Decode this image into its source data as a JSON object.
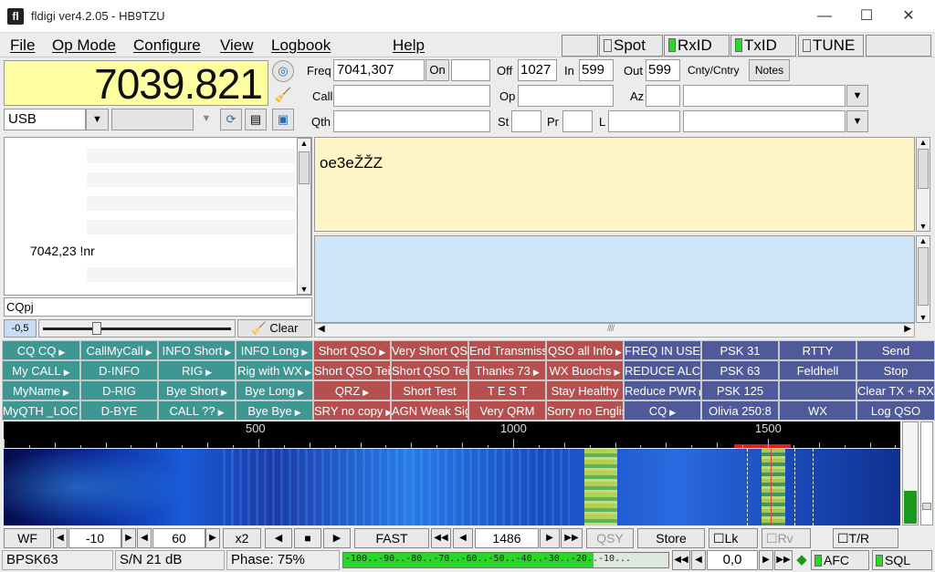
{
  "window": {
    "title": "fldigi ver4.2.05 - HB9TZU",
    "minimize": "—",
    "maximize": "☐",
    "close": "✕",
    "app_icon": "fl"
  },
  "menu": [
    "File",
    "Op Mode",
    "Configure",
    "View",
    "Logbook",
    "Help"
  ],
  "toggles": {
    "spot": "Spot",
    "rxid": "RxID",
    "txid": "TxID",
    "tune": "TUNE"
  },
  "frequency": {
    "display": "7039.821",
    "mode": "USB"
  },
  "log": {
    "freq_label": "Freq",
    "freq_value": "7041,307",
    "on_label": "On",
    "on_value": "",
    "off_label": "Off",
    "off_value": "1027",
    "in_label": "In",
    "in_value": "599",
    "out_label": "Out",
    "out_value": "599",
    "cnty_label": "Cnty/Cntry",
    "notes_label": "Notes",
    "call_label": "Call",
    "op_label": "Op",
    "az_label": "Az",
    "qth_label": "Qth",
    "st_label": "St",
    "pr_label": "Pr",
    "l_label": "L"
  },
  "browser": {
    "entry": "7042,23 !nr",
    "entry_freq": "7042,23",
    "entry_text": "!nr",
    "filter": "CQpj",
    "squelch_value": "-0,5",
    "clear_label": "Clear"
  },
  "rx_text": "oe3eŽŽZ",
  "macros": [
    [
      {
        "label": "CQ CQ",
        "color": "teal",
        "arrow": true
      },
      {
        "label": "CallMyCall",
        "color": "teal",
        "arrow": true
      },
      {
        "label": "INFO Short",
        "color": "teal",
        "arrow": true
      },
      {
        "label": "INFO Long",
        "color": "teal",
        "arrow": true
      },
      {
        "label": "Short QSO",
        "color": "red",
        "arrow": true
      },
      {
        "label": "Very Short QSO",
        "color": "red",
        "arrow": false
      },
      {
        "label": "End Transmission",
        "color": "red",
        "arrow": false
      },
      {
        "label": "QSO all Info",
        "color": "red",
        "arrow": true
      },
      {
        "label": "FREQ IN USE",
        "color": "blue",
        "arrow": true
      },
      {
        "label": "PSK 31",
        "color": "blue",
        "arrow": false
      },
      {
        "label": "RTTY",
        "color": "blue",
        "arrow": false
      },
      {
        "label": "Send",
        "color": "blue",
        "arrow": false
      }
    ],
    [
      {
        "label": "My CALL",
        "color": "teal",
        "arrow": true
      },
      {
        "label": "D-INFO",
        "color": "teal",
        "arrow": false
      },
      {
        "label": "RIG",
        "color": "teal",
        "arrow": true
      },
      {
        "label": "Rig with WX",
        "color": "teal",
        "arrow": true
      },
      {
        "label": "Short QSO Teil 1",
        "color": "red",
        "arrow": false
      },
      {
        "label": "Short QSO Teil 2",
        "color": "red",
        "arrow": false
      },
      {
        "label": "Thanks 73",
        "color": "red",
        "arrow": true
      },
      {
        "label": "WX Buochs",
        "color": "red",
        "arrow": true
      },
      {
        "label": "REDUCE ALC",
        "color": "blue",
        "arrow": true
      },
      {
        "label": "PSK 63",
        "color": "blue",
        "arrow": false
      },
      {
        "label": "Feldhell",
        "color": "blue",
        "arrow": false
      },
      {
        "label": "Stop",
        "color": "blue",
        "arrow": false
      }
    ],
    [
      {
        "label": "MyName",
        "color": "teal",
        "arrow": true
      },
      {
        "label": "D-RIG",
        "color": "teal",
        "arrow": false
      },
      {
        "label": "Bye Short",
        "color": "teal",
        "arrow": true
      },
      {
        "label": "Bye Long",
        "color": "teal",
        "arrow": true
      },
      {
        "label": "QRZ",
        "color": "red",
        "arrow": true
      },
      {
        "label": "Short Test",
        "color": "red",
        "arrow": false
      },
      {
        "label": "T E S T",
        "color": "red",
        "arrow": false
      },
      {
        "label": "Stay Healthy",
        "color": "red",
        "arrow": false
      },
      {
        "label": "Reduce PWR",
        "color": "blue",
        "arrow": true
      },
      {
        "label": "PSK 125",
        "color": "blue",
        "arrow": false
      },
      {
        "label": "",
        "color": "blue",
        "arrow": false
      },
      {
        "label": "Clear TX + RX",
        "color": "blue",
        "arrow": false
      }
    ],
    [
      {
        "label": "MyQTH _LOC",
        "color": "teal",
        "arrow": true
      },
      {
        "label": "D-BYE",
        "color": "teal",
        "arrow": false
      },
      {
        "label": "CALL ??",
        "color": "teal",
        "arrow": true
      },
      {
        "label": "Bye Bye",
        "color": "teal",
        "arrow": true
      },
      {
        "label": "SRY no copy",
        "color": "red",
        "arrow": true
      },
      {
        "label": "AGN Weak Signal",
        "color": "red",
        "arrow": false
      },
      {
        "label": "Very QRM",
        "color": "red",
        "arrow": false
      },
      {
        "label": "Sorry no English",
        "color": "red",
        "arrow": false
      },
      {
        "label": "CQ",
        "color": "blue",
        "arrow": true
      },
      {
        "label": "Olivia 250:8",
        "color": "blue",
        "arrow": false
      },
      {
        "label": "WX",
        "color": "blue",
        "arrow": false
      },
      {
        "label": "Log QSO",
        "color": "blue",
        "arrow": false
      }
    ]
  ],
  "waterfall": {
    "scale_labels": [
      "500",
      "1000",
      "1500"
    ],
    "mode_button": "WF",
    "ref_level": "-10",
    "range": "60",
    "zoom": "x2",
    "speed": "FAST",
    "carrier": "1486",
    "qsy": "QSY",
    "store": "Store",
    "lk": "Lk",
    "rv": "Rv",
    "tr": "T/R"
  },
  "statusbar": {
    "mode": "BPSK63",
    "snr": "S/N 21 dB",
    "phase": "Phase: 75%",
    "meter_scale": "-100..-90..-80..-70..-60..-50..-40..-30..-20..-10...",
    "meter_level": 0.77,
    "offset": "0,0",
    "afc": "AFC",
    "sql": "SQL"
  },
  "colors": {
    "teal": "#3f9793",
    "red": "#b5504f",
    "blue": "#4f5a9a",
    "freq_bg": "#fffea0",
    "rx_bg": "#fdf5c8",
    "tx_bg": "#cfe6f8",
    "led_green": "#22dd22"
  }
}
